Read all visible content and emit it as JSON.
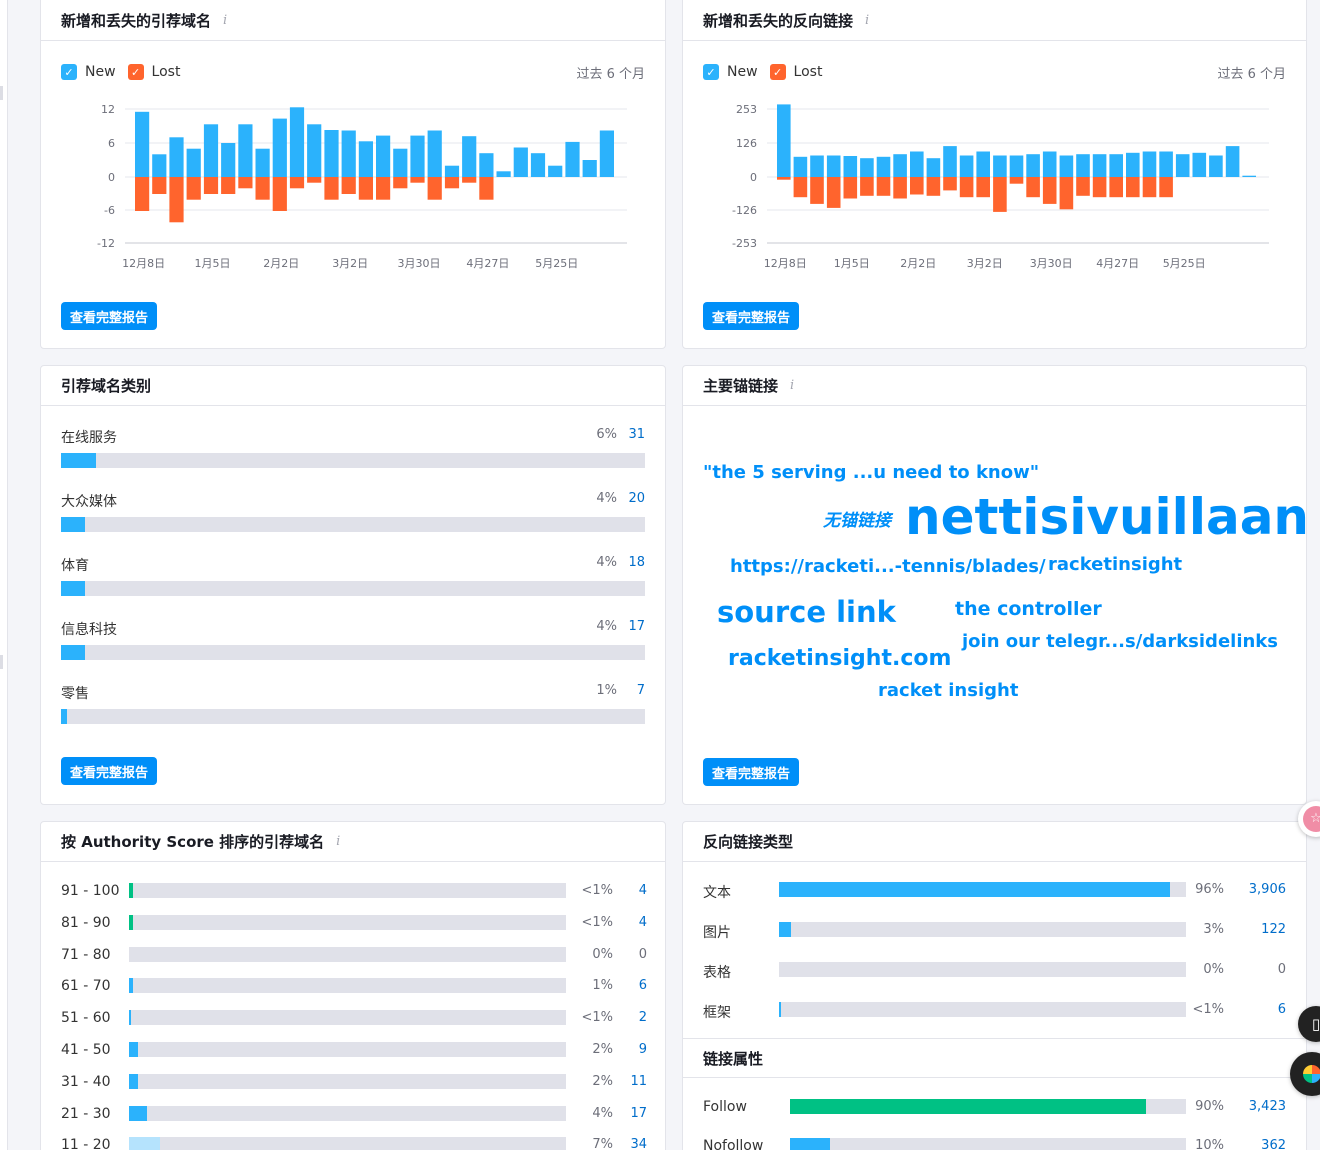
{
  "colors": {
    "new": "#2bb2fc",
    "lost": "#ff642d",
    "accent": "#008ff8",
    "link": "#006dca",
    "bar": "#2bb2fc",
    "green": "#00c184",
    "light": "#b5e3fd"
  },
  "ref_domains_chart": {
    "title": "新增和丢失的引荐域名",
    "info_icon": "info-icon",
    "legend": {
      "new": "New",
      "lost": "Lost"
    },
    "period": "过去 6 个月",
    "button": "查看完整报告",
    "chart_data": {
      "type": "bar",
      "ylim": [
        -12,
        12
      ],
      "yticks": [
        "12",
        "6",
        "0",
        "-6",
        "-12"
      ],
      "xticks": [
        "12月8日",
        "1月5日",
        "2月2日",
        "3月2日",
        "3月30日",
        "4月27日",
        "5月25日"
      ],
      "series": [
        {
          "name": "New",
          "values": [
            11.5,
            4,
            7,
            5,
            9.3,
            6,
            9.3,
            5,
            10.3,
            12.3,
            9.3,
            8.3,
            8.2,
            6.3,
            7.3,
            5,
            7.3,
            8.2,
            2,
            7.2,
            4.2,
            1,
            5.2,
            4.2,
            2,
            6.2,
            3,
            8.2
          ],
          "color": "#2bb2fc"
        },
        {
          "name": "Lost",
          "values": [
            -6,
            -3,
            -8,
            -4,
            -3,
            -3,
            -2,
            -4,
            -6,
            -2,
            -1,
            -4,
            -3,
            -4,
            -4,
            -2,
            -1,
            -4,
            -2,
            -1,
            -4,
            0,
            0,
            0,
            0,
            0,
            0,
            0
          ],
          "color": "#ff642d"
        }
      ]
    }
  },
  "backlinks_chart": {
    "title": "新增和丢失的反向链接",
    "info_icon": "info-icon",
    "legend": {
      "new": "New",
      "lost": "Lost"
    },
    "period": "过去 6 个月",
    "button": "查看完整报告",
    "chart_data": {
      "type": "bar",
      "ylim": [
        -253,
        253
      ],
      "yticks": [
        "253",
        "126",
        "0",
        "-126",
        "-253"
      ],
      "xticks": [
        "12月8日",
        "1月5日",
        "2月2日",
        "3月2日",
        "3月30日",
        "4月27日",
        "5月25日"
      ],
      "series": [
        {
          "name": "New",
          "values": [
            270,
            75,
            80,
            80,
            78,
            70,
            75,
            85,
            95,
            70,
            115,
            80,
            95,
            80,
            80,
            85,
            95,
            80,
            85,
            85,
            85,
            90,
            95,
            95,
            85,
            90,
            80,
            115,
            5
          ],
          "color": "#2bb2fc"
        },
        {
          "name": "Lost",
          "values": [
            -10,
            -75,
            -100,
            -115,
            -80,
            -70,
            -70,
            -80,
            -65,
            -70,
            -50,
            -75,
            -75,
            -130,
            -25,
            -75,
            -100,
            -120,
            -70,
            -75,
            -75,
            -75,
            -75,
            -75,
            0,
            0,
            0,
            0,
            0
          ],
          "color": "#ff642d"
        }
      ]
    }
  },
  "categories": {
    "title": "引荐域名类别",
    "button": "查看完整报告",
    "items": [
      {
        "name": "在线服务",
        "pct": "6%",
        "count": "31",
        "fill": 0.06
      },
      {
        "name": "大众媒体",
        "pct": "4%",
        "count": "20",
        "fill": 0.04
      },
      {
        "name": "体育",
        "pct": "4%",
        "count": "18",
        "fill": 0.04
      },
      {
        "name": "信息科技",
        "pct": "4%",
        "count": "17",
        "fill": 0.04
      },
      {
        "name": "零售",
        "pct": "1%",
        "count": "7",
        "fill": 0.01
      }
    ]
  },
  "anchors": {
    "title": "主要锚链接",
    "info_icon": "info-icon",
    "button": "查看完整报告",
    "words": [
      "\"the 5 serving ...u need to know\"",
      "无锚链接",
      "nettisivuillaan",
      "https://racketi...-tennis/blades/",
      "racketinsight",
      "source link",
      "the controller",
      "join our telegr...s/darksidelinks",
      "racketinsight.com",
      "racket insight"
    ]
  },
  "authority": {
    "title": "按 Authority Score 排序的引荐域名",
    "info_icon": "info-icon",
    "rows": [
      {
        "range": "91 - 100",
        "pct": "<1%",
        "count": "4",
        "fill": 0.008,
        "color": "#00c184"
      },
      {
        "range": "81 - 90",
        "pct": "<1%",
        "count": "4",
        "fill": 0.008,
        "color": "#00c184"
      },
      {
        "range": "71 - 80",
        "pct": "0%",
        "count": "0",
        "fill": 0,
        "color": "#2bb2fc"
      },
      {
        "range": "61 - 70",
        "pct": "1%",
        "count": "6",
        "fill": 0.01,
        "color": "#2bb2fc"
      },
      {
        "range": "51 - 60",
        "pct": "<1%",
        "count": "2",
        "fill": 0.004,
        "color": "#2bb2fc"
      },
      {
        "range": "41 - 50",
        "pct": "2%",
        "count": "9",
        "fill": 0.02,
        "color": "#2bb2fc"
      },
      {
        "range": "31 - 40",
        "pct": "2%",
        "count": "11",
        "fill": 0.02,
        "color": "#2bb2fc"
      },
      {
        "range": "21 - 30",
        "pct": "4%",
        "count": "17",
        "fill": 0.04,
        "color": "#2bb2fc"
      },
      {
        "range": "11 - 20",
        "pct": "7%",
        "count": "34",
        "fill": 0.07,
        "color": "#b5e3fd"
      }
    ]
  },
  "link_types": {
    "title": "反向链接类型",
    "rows": [
      {
        "name": "文本",
        "pct": "96%",
        "count": "3,906",
        "fill": 0.96
      },
      {
        "name": "图片",
        "pct": "3%",
        "count": "122",
        "fill": 0.03
      },
      {
        "name": "表格",
        "pct": "0%",
        "count": "0",
        "fill": 0
      },
      {
        "name": "框架",
        "pct": "<1%",
        "count": "6",
        "fill": 0.004
      }
    ]
  },
  "link_attrs": {
    "title": "链接属性",
    "rows": [
      {
        "name": "Follow",
        "pct": "90%",
        "count": "3,423",
        "fill": 0.9,
        "color": "#00c184"
      },
      {
        "name": "Nofollow",
        "pct": "10%",
        "count": "362",
        "fill": 0.1,
        "color": "#2bb2fc"
      }
    ]
  },
  "floating": {
    "icons": [
      "app-badge-icon",
      "book-icon",
      "extension-icon"
    ]
  }
}
